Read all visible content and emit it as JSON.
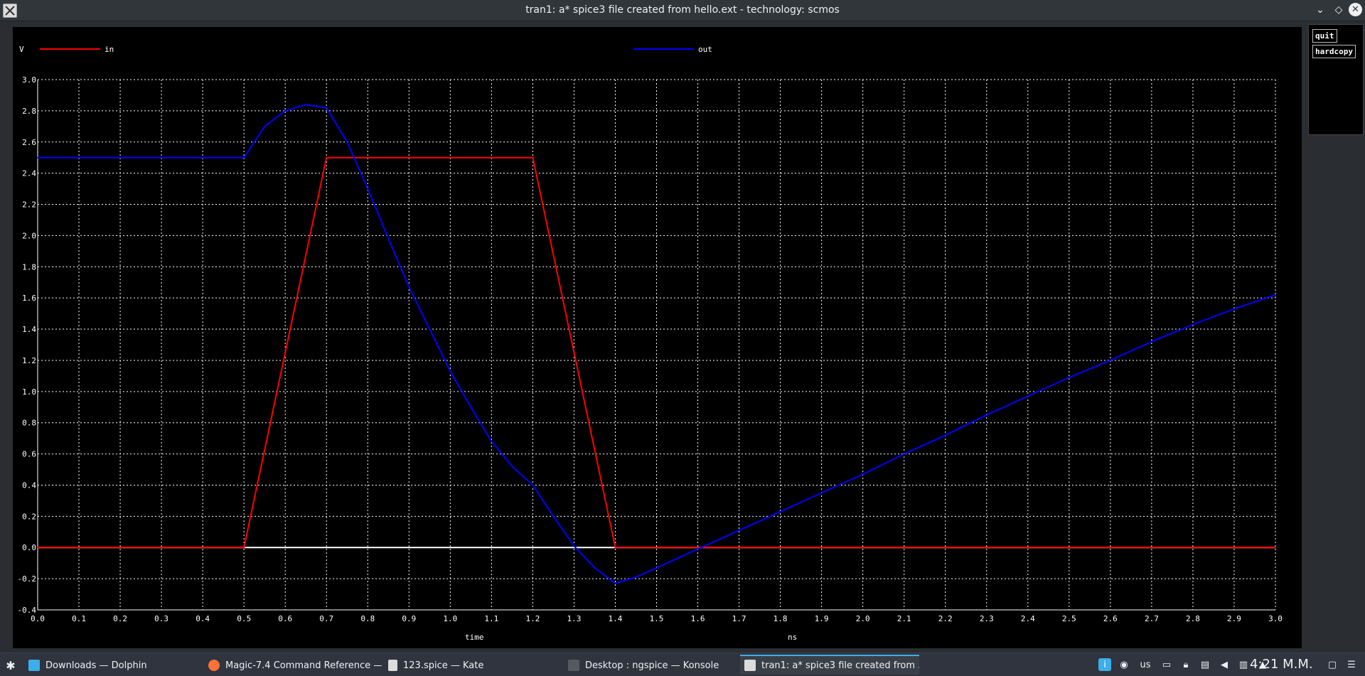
{
  "window": {
    "title": "tran1: a* spice3 file created from hello.ext - technology: scmos",
    "controls": {
      "minimize": "⌄",
      "maximize": "◇",
      "close": "✕"
    }
  },
  "side_panel": {
    "quit_label": "quit",
    "hardcopy_label": "hardcopy"
  },
  "chart_data": {
    "type": "line",
    "ylabel": "V",
    "xlabel": "time",
    "xunit": "ns",
    "xlim": [
      0.0,
      3.0
    ],
    "ylim": [
      -0.4,
      3.0
    ],
    "x_ticks": [
      "0.0",
      "0.1",
      "0.2",
      "0.3",
      "0.4",
      "0.5",
      "0.6",
      "0.7",
      "0.8",
      "0.9",
      "1.0",
      "1.1",
      "1.2",
      "1.3",
      "1.4",
      "1.5",
      "1.6",
      "1.7",
      "1.8",
      "1.9",
      "2.0",
      "2.1",
      "2.2",
      "2.3",
      "2.4",
      "2.5",
      "2.6",
      "2.7",
      "2.8",
      "2.9",
      "3.0"
    ],
    "y_ticks": [
      "3.0",
      "2.8",
      "2.6",
      "2.4",
      "2.2",
      "2.0",
      "1.8",
      "1.6",
      "1.4",
      "1.2",
      "1.0",
      "0.8",
      "0.6",
      "0.4",
      "0.2",
      "0.0",
      "-0.2",
      "-0.4"
    ],
    "grid": true,
    "colors": {
      "background": "#000000",
      "grid": "#ffffff",
      "axis": "#ffffff",
      "text": "#ffffff"
    },
    "series": [
      {
        "name": "in",
        "color": "#ff0000",
        "x": [
          0.0,
          0.5,
          0.7,
          1.2,
          1.4,
          3.0
        ],
        "y": [
          0.0,
          0.0,
          2.5,
          2.5,
          0.0,
          0.0
        ]
      },
      {
        "name": "out",
        "color": "#0000ff",
        "x": [
          0.0,
          0.5,
          0.55,
          0.6,
          0.65,
          0.7,
          0.75,
          0.8,
          0.85,
          0.9,
          0.95,
          1.0,
          1.05,
          1.1,
          1.15,
          1.2,
          1.25,
          1.3,
          1.35,
          1.4,
          1.45,
          1.5,
          1.6,
          1.7,
          1.8,
          1.9,
          2.0,
          2.1,
          2.2,
          2.3,
          2.4,
          2.5,
          2.6,
          2.7,
          2.8,
          2.9,
          3.0
        ],
        "y": [
          2.5,
          2.5,
          2.7,
          2.8,
          2.84,
          2.82,
          2.6,
          2.3,
          1.98,
          1.67,
          1.4,
          1.13,
          0.9,
          0.68,
          0.52,
          0.4,
          0.2,
          0.01,
          -0.13,
          -0.23,
          -0.19,
          -0.13,
          -0.01,
          0.11,
          0.23,
          0.35,
          0.47,
          0.6,
          0.72,
          0.85,
          0.97,
          1.09,
          1.2,
          1.32,
          1.43,
          1.53,
          1.62
        ]
      }
    ]
  },
  "taskbar": {
    "tasks": [
      {
        "label": "Downloads — Dolphin",
        "icon": "folder-icon",
        "color": "#3daee9"
      },
      {
        "label": "Magic-7.4 Command Reference —...",
        "icon": "firefox-icon",
        "color": "#ff7139"
      },
      {
        "label": "123.spice  — Kate",
        "icon": "document-icon",
        "color": "#dcdcdc"
      },
      {
        "label": "Desktop : ngspice — Konsole",
        "icon": "terminal-icon",
        "color": "#555a61"
      },
      {
        "label": "tran1: a* spice3 file created from ...",
        "icon": "x11-icon",
        "color": "#dcdcdc"
      }
    ],
    "keyboard_layout": "us",
    "clock": "4:21 M.M."
  }
}
